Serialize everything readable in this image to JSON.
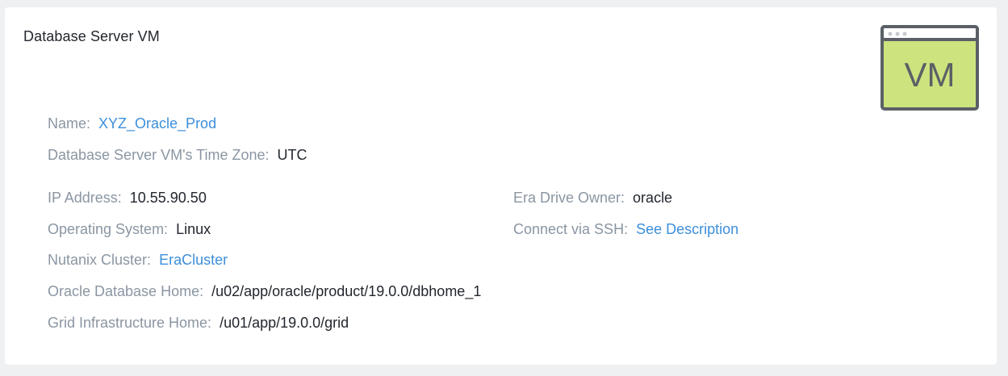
{
  "card": {
    "title": "Database Server VM",
    "icon_text": "VM",
    "colors": {
      "icon_fill": "#cde47e",
      "icon_stroke": "#5a6066",
      "link": "#3d8fdb",
      "label": "#8a96a3",
      "value": "#22272e"
    }
  },
  "details": {
    "name_label": "Name:",
    "name_value": "XYZ_Oracle_Prod",
    "timezone_label": "Database Server VM's Time Zone:",
    "timezone_value": "UTC",
    "ip_label": "IP Address:",
    "ip_value": "10.55.90.50",
    "os_label": "Operating System:",
    "os_value": "Linux",
    "cluster_label": "Nutanix Cluster:",
    "cluster_value": "EraCluster",
    "oracle_home_label": "Oracle Database Home:",
    "oracle_home_value": "/u02/app/oracle/product/19.0.0/dbhome_1",
    "grid_home_label": "Grid Infrastructure Home:",
    "grid_home_value": "/u01/app/19.0.0/grid",
    "drive_owner_label": "Era Drive Owner:",
    "drive_owner_value": "oracle",
    "ssh_label": "Connect via SSH:",
    "ssh_value": "See Description"
  }
}
